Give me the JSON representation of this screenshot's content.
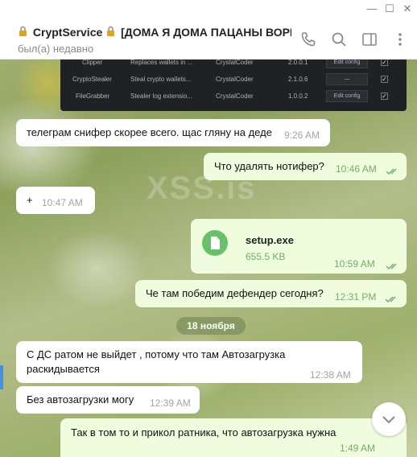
{
  "window": {
    "minimize": "—",
    "maximize": "☐",
    "close": "✕"
  },
  "header": {
    "title": "CryptService 🔐 [ДОМА Я ДОМА ПАЦАНЫ ВОРК...",
    "title_name": "CryptService",
    "title_rest": "[ДОМА Я ДОМА ПАЦАНЫ ВОРК...",
    "status": "был(а) недавно",
    "icons": [
      "phone-icon",
      "search-icon",
      "sidebar-toggle-icon",
      "more-vertical-icon"
    ]
  },
  "watermark": "XSS.is",
  "embedded_table": {
    "rows": [
      {
        "name": "Clipper",
        "description": "Replaces wallets in ...",
        "author": "CrystalCoder",
        "version": "2.0.0.1",
        "action": "Edit config",
        "checked": "✓"
      },
      {
        "name": "CryptoStealer",
        "description": "Steal crypto wallets...",
        "author": "CrystalCoder",
        "version": "2.1.0.6",
        "action": "—",
        "checked": "✓"
      },
      {
        "name": "FileGrabber",
        "description": "Stealer log extensio...",
        "author": "CrystalCoder",
        "version": "1.0.0.2",
        "action": "Edit config",
        "checked": "✓"
      }
    ]
  },
  "messages": [
    {
      "direction": "incoming",
      "text": "телеграм снифер скорее всего. щас гляну на деде",
      "time": "9:26 AM"
    },
    {
      "direction": "outgoing",
      "text": "Что удалять нотифер?",
      "time": "10:46 AM"
    },
    {
      "direction": "incoming",
      "text": "+",
      "time": "10:47 AM"
    },
    {
      "direction": "outgoing",
      "type": "file",
      "file_name": "setup.exe",
      "file_size": "655.5 KB",
      "time": "10:59 AM"
    },
    {
      "direction": "outgoing",
      "text": "Че там победим дефендер сегодня?",
      "time": "12:31 PM"
    },
    {
      "direction": "incoming",
      "text_line1": "С ДС ратом не выйдет , потому что там Автозагрузка",
      "text_line2": "раскидывается",
      "time": "12:38 AM"
    },
    {
      "direction": "incoming",
      "text": "Без автозагрузки могу",
      "time": "12:39 AM"
    },
    {
      "direction": "outgoing",
      "text": "Так в том то и прикол ратника, что автозагрузка нужна",
      "time": "1:49 AM"
    }
  ],
  "date_separator": "18 ноября",
  "colors": {
    "outgoing_bubble": "#effdde",
    "incoming_bubble": "#ffffff",
    "accent_green": "#6fb06a",
    "file_icon": "#69c06b"
  }
}
